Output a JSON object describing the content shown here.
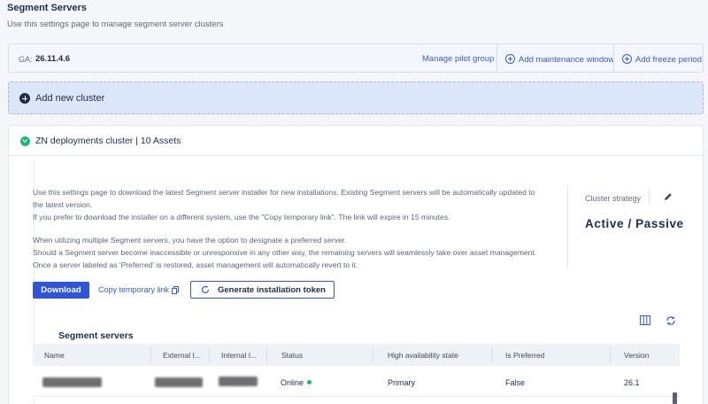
{
  "header": {
    "title": "Segment Servers",
    "subtitle": "Use this settings page to manage segment server clusters"
  },
  "ga_bar": {
    "label": "GA:",
    "version": "26.11.4.6",
    "manage_pilot": "Manage pilot group",
    "add_maintenance": "Add maintenance window",
    "add_freeze": "Add freeze period"
  },
  "add_cluster": {
    "label": "Add new cluster"
  },
  "cluster": {
    "title": "ZN deployments cluster | 10 Assets",
    "section_title": "Segment servers",
    "description": [
      "Use this settings page to download the latest Segment server installer for new installations. Existing Segment servers will be automatically updated to",
      "the latest version.",
      "If you prefer to download the installer on a different system, use the \"Copy temporary link\". The link will expire in 15 minutes.",
      "",
      "When utilizing multiple Segment servers, you have the option to designate a preferred server.",
      "Should a Segment server become inaccessible or unresponsive in any other way, the remaining servers will seamlessly take over asset management.",
      "Once a server labeled as 'Preferred' is restored, asset management will automatically revert to it."
    ],
    "strategy_label": "Cluster strategy",
    "strategy_value": "Active / Passive",
    "download_label": "Download",
    "copy_link_label": "Copy temporary link",
    "token_label": "Generate installation token"
  },
  "table": {
    "columns": [
      "Name",
      "External I...",
      "Internal I...",
      "Status",
      "High availability state",
      "Is Preferred",
      "Version"
    ],
    "rows": [
      {
        "name": "",
        "external_ip": "",
        "internal_ip": "",
        "status": "Online",
        "ha_state": "Primary",
        "is_preferred": "False",
        "version": "26.1"
      }
    ]
  },
  "colors": {
    "accent": "#2f55d4",
    "online": "#1eb77a",
    "title": "#1d2b4f"
  },
  "icons": [
    "plus-circle-icon",
    "chevron-down-icon",
    "pencil-icon",
    "copy-icon",
    "refresh-icon",
    "columns-icon",
    "reload-icon"
  ]
}
